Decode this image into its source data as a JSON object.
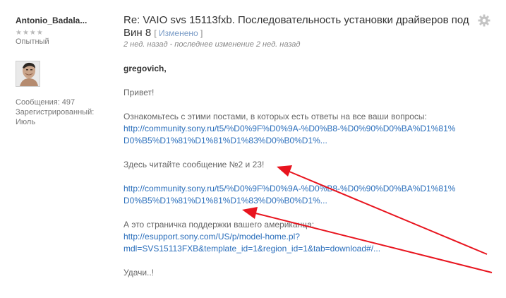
{
  "author": {
    "name": "Antonio_Badala...",
    "stars": "★★★★",
    "rank": "Опытный",
    "messages": "Сообщения: 497",
    "registered_label": "Зарегистрированный:",
    "registered_value": "Июль"
  },
  "post": {
    "title": "Re: VAIO svs 15113fxb. Последовательность установки драйверов под Вин 8",
    "edited_open": "[",
    "edited_link": "Изменено",
    "edited_close": "]",
    "timestamp": "2 нед. назад - последнее изменение 2 нед. назад",
    "salutation": "gregovich,",
    "greeting": "Привет!",
    "intro": "Ознакомьтесь с этими постами, в которых есть ответы на все ваши вопросы:",
    "link1_line1": "http://community.sony.ru/t5/%D0%9F%D0%9A-%D0%B8-%D0%90%D0%BA%D1%81%",
    "link1_line2": "D0%B5%D1%81%D1%81%D1%83%D0%B0%D1%...",
    "read_message": "Здесь читайте сообщение №2 и 23!",
    "link2_line1": "http://community.sony.ru/t5/%D0%9F%D0%9A-%D0%B8-%D0%90%D0%BA%D1%81%",
    "link2_line2": "D0%B5%D1%81%D1%81%D1%83%D0%B0%D1%...",
    "support_text": "А это страничка поддержки вашего американца:",
    "link3_line1": "http://esupport.sony.com/US/p/model-home.pl?",
    "link3_line2": "mdl=SVS15113FXB&template_id=1&region_id=1&tab=download#/...",
    "closing": "Удачи..!"
  },
  "icons": {
    "gear": "gear-icon",
    "annotation_arrows": "red-arrow-icon"
  },
  "colors": {
    "link": "#2a6ebb",
    "arrow": "#e8141e",
    "muted": "#888888"
  }
}
